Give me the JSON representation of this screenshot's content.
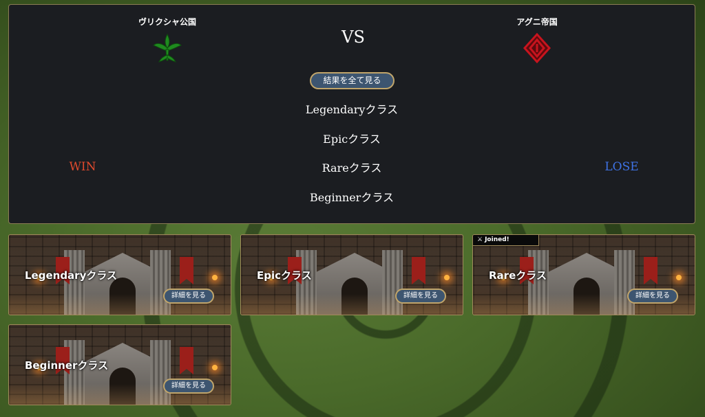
{
  "battle": {
    "left_faction": "ヴリクシャ公国",
    "right_faction": "アグニ帝国",
    "vs": "VS",
    "all_results_button": "結果を全て見る",
    "classes": [
      "Legendaryクラス",
      "Epicクラス",
      "Rareクラス",
      "Beginnerクラス"
    ],
    "left_result": "WIN",
    "right_result": "LOSE",
    "colors": {
      "win": "#e04a2d",
      "lose": "#3f73e6",
      "left_emblem": "#1f8a1f",
      "right_emblem": "#c8141e"
    },
    "icons": {
      "left_emblem": "leaf-crest-icon",
      "right_emblem": "flame-crest-icon"
    }
  },
  "cards": [
    {
      "title": "Legendaryクラス",
      "detail_button": "詳細を見る",
      "joined": false
    },
    {
      "title": "Epicクラス",
      "detail_button": "詳細を見る",
      "joined": false
    },
    {
      "title": "Rareクラス",
      "detail_button": "詳細を見る",
      "joined": true,
      "joined_label": "Joined!"
    },
    {
      "title": "Beginnerクラス",
      "detail_button": "詳細を見る",
      "joined": false
    }
  ]
}
